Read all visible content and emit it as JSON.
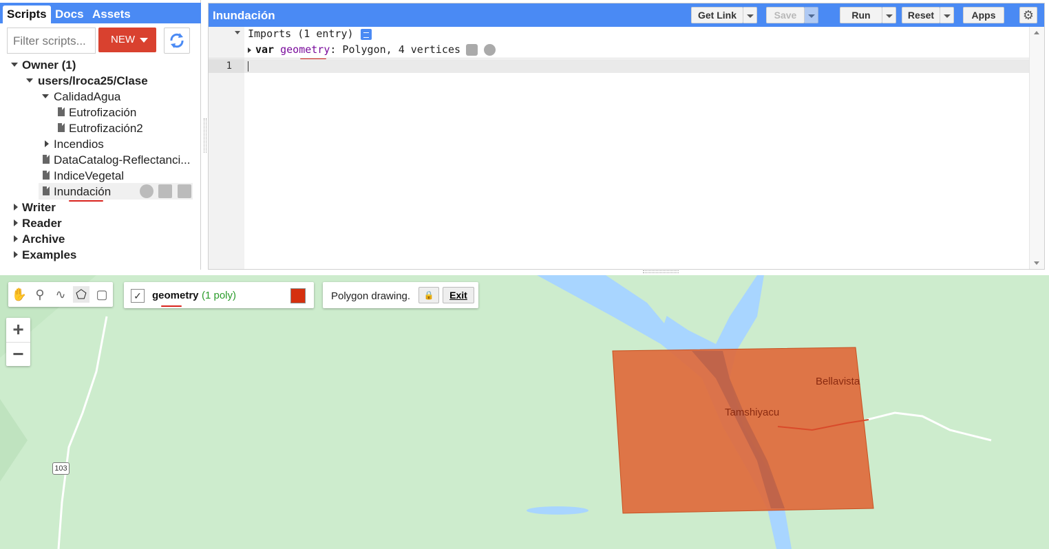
{
  "left_panel": {
    "tabs": [
      "Scripts",
      "Docs",
      "Assets"
    ],
    "filter_placeholder": "Filter scripts...",
    "new_label": "NEW",
    "tree": {
      "owner": "Owner (1)",
      "user_repo": "users/lroca25/Clase",
      "folder_calidad": "CalidadAgua",
      "file_eutro1": "Eutrofización",
      "file_eutro2": "Eutrofización2",
      "folder_incendios": "Incendios",
      "file_datacatalog": "DataCatalog-Reflectanci...",
      "file_indice": "IndiceVegetal",
      "file_inundacion": "Inundación",
      "writer": "Writer",
      "reader": "Reader",
      "archive": "Archive",
      "examples": "Examples"
    }
  },
  "editor": {
    "title": "Inundación",
    "buttons": {
      "get_link": "Get Link",
      "save": "Save",
      "run": "Run",
      "reset": "Reset",
      "apps": "Apps"
    },
    "imports_header": "Imports (1 entry)",
    "import_line": {
      "keyword": "var",
      "name": "geometry",
      "rest": ": Polygon, 4 vertices"
    },
    "line_number": "1"
  },
  "map": {
    "geometry_layer": {
      "name": "geometry",
      "count": "(1 poly)",
      "color": "#d5300f"
    },
    "drawing_status": {
      "text": "Polygon drawing.",
      "exit_label": "Exit"
    },
    "zoom_in": "+",
    "zoom_out": "−",
    "places": [
      "Bellavista",
      "Tamshiyacu"
    ],
    "road_shield": "103",
    "colors": {
      "land": "#cdeccd",
      "water": "#a8d5ff",
      "polygon": "#e06a3c"
    }
  }
}
